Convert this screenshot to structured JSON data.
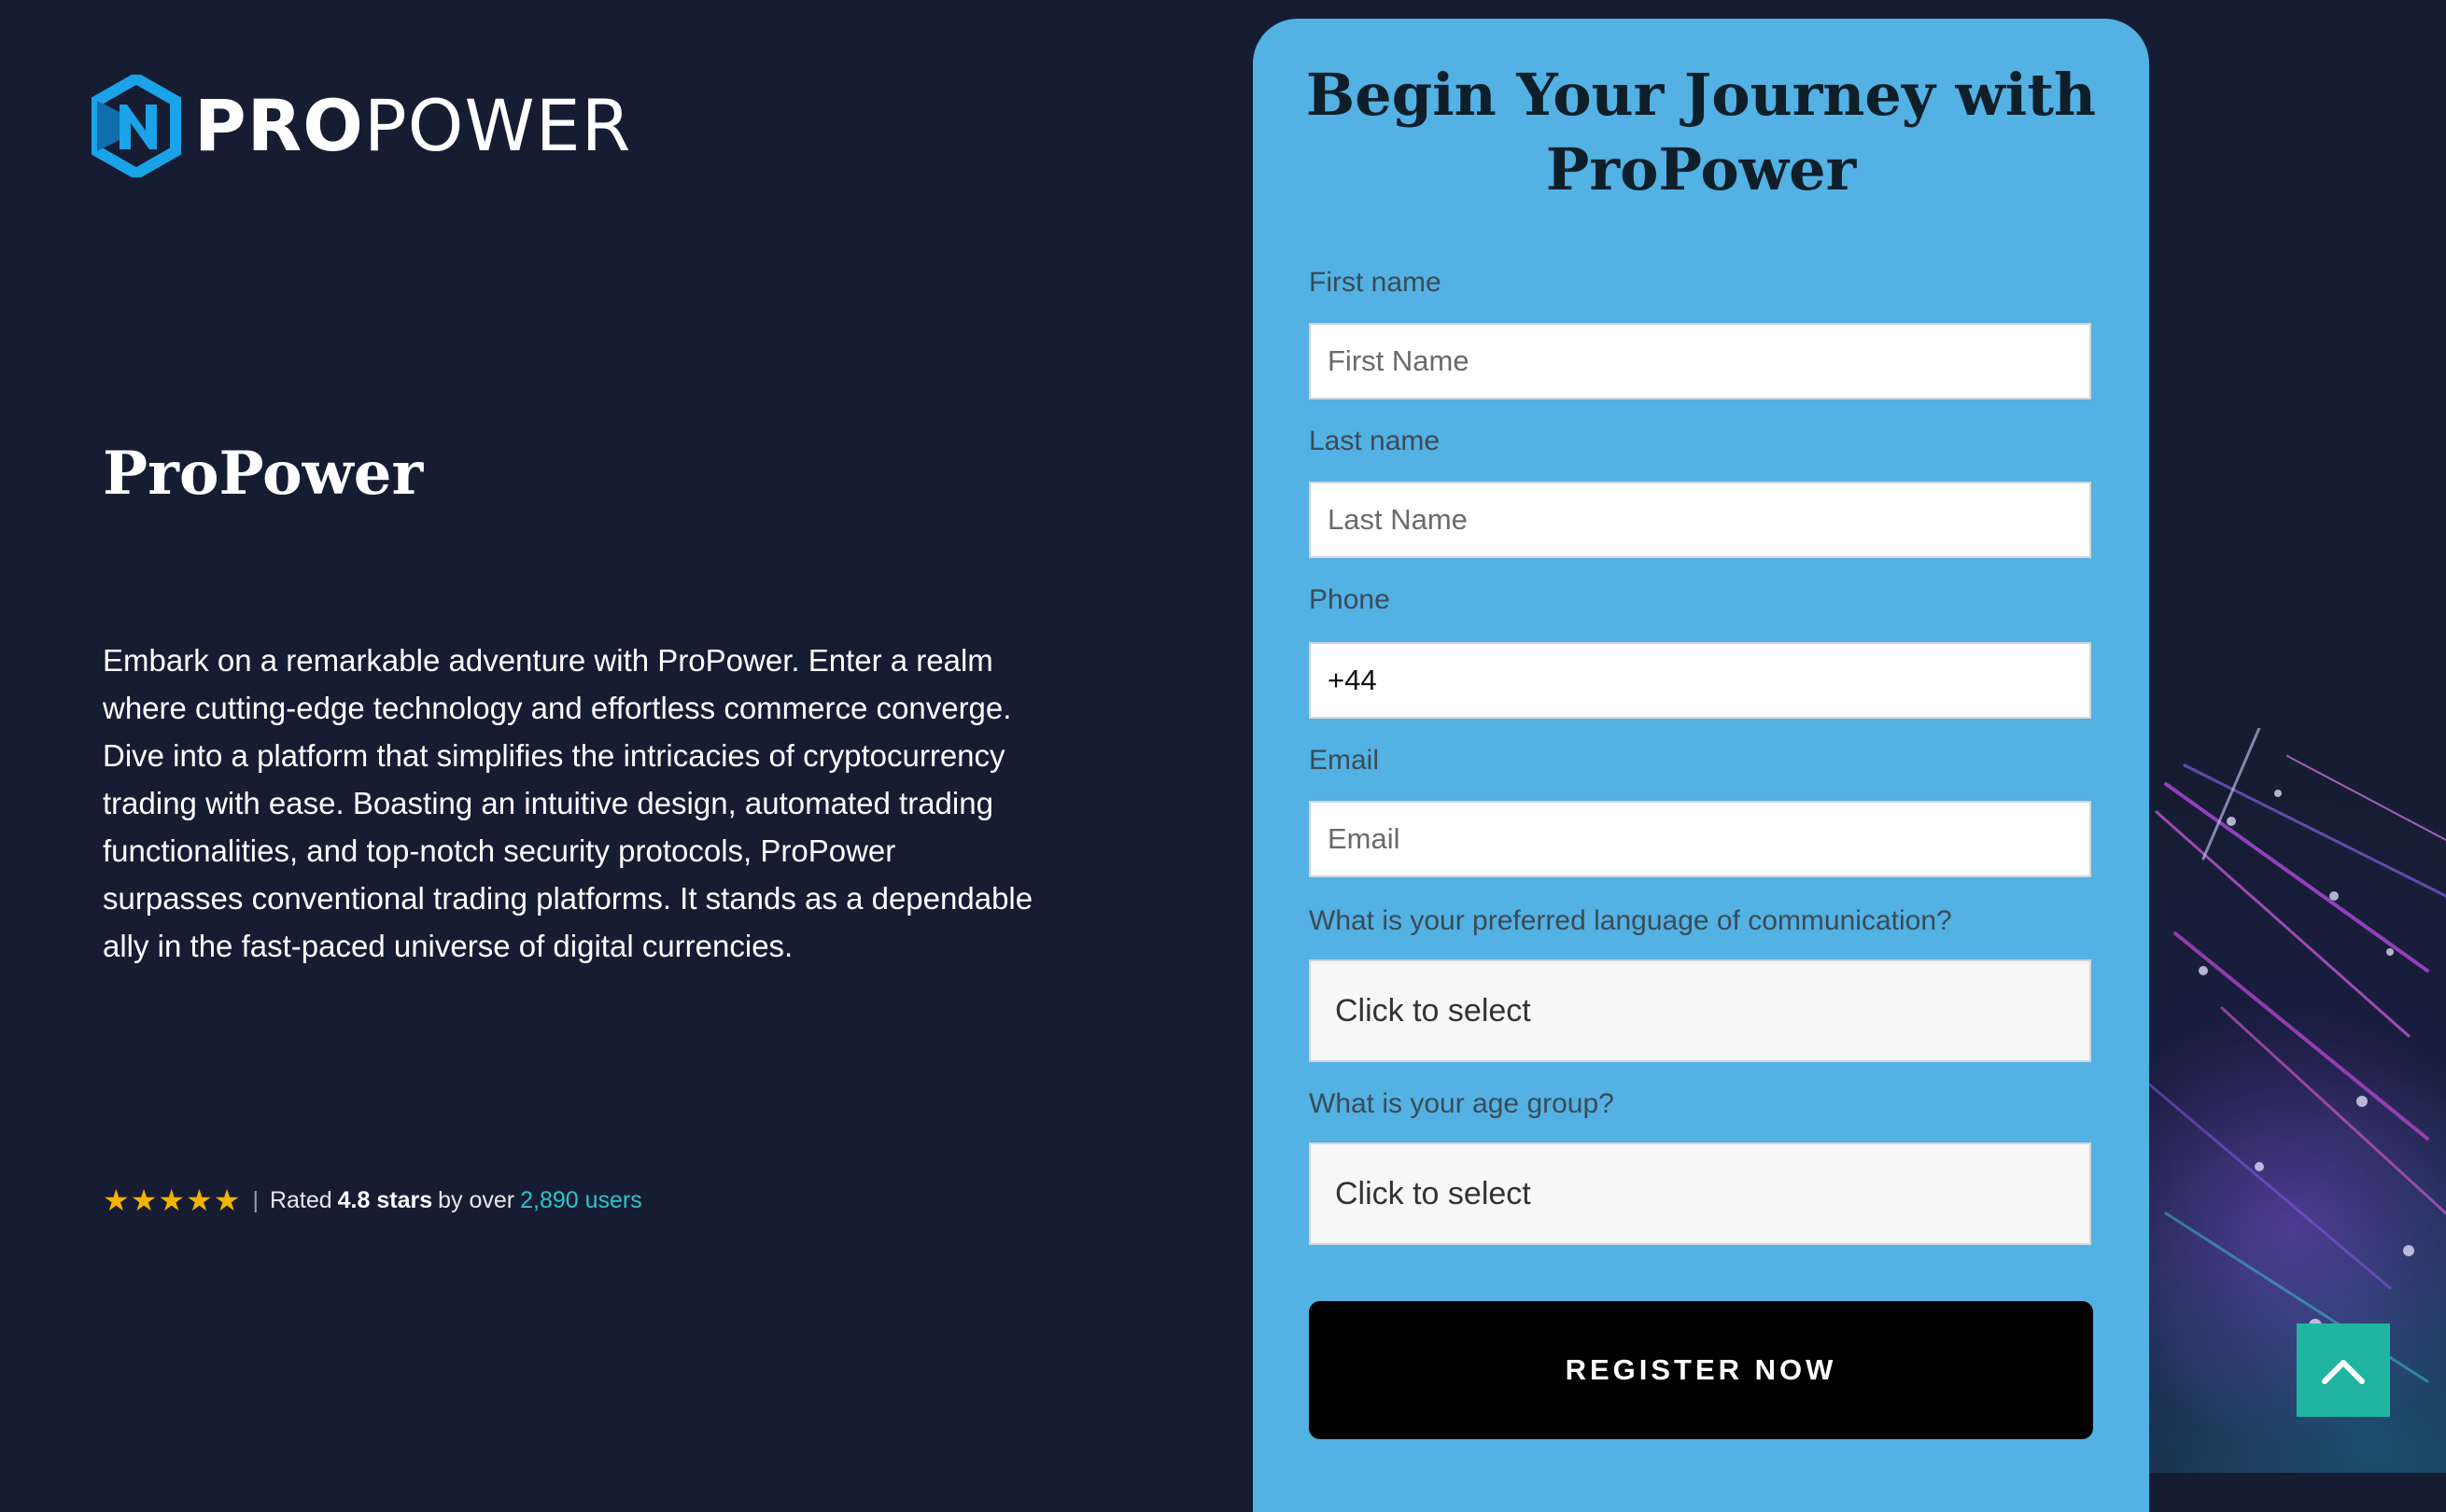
{
  "brand": {
    "logo_bold": "PRO",
    "logo_light": "POWER"
  },
  "hero": {
    "title": "ProPower",
    "description": "Embark on a remarkable adventure with ProPower. Enter a realm where cutting-edge technology and effortless commerce converge. Dive into a platform that simplifies the intricacies of cryptocurrency trading with ease. Boasting an intuitive design, automated trading functionalities, and top-notch security protocols, ProPower surpasses conventional trading platforms. It stands as a dependable ally in the fast-paced universe of digital currencies."
  },
  "rating": {
    "stars": "★★★★★",
    "separator": "|",
    "prefix": "Rated",
    "score": "4.8 stars",
    "by": "by over",
    "users": "2,890 users",
    "star_color": "#f5b301",
    "users_color": "#2ec4c9"
  },
  "form": {
    "title": "Begin Your Journey with ProPower",
    "first_name_label": "First name",
    "first_name_placeholder": "First Name",
    "last_name_label": "Last name",
    "last_name_placeholder": "Last Name",
    "phone_label": "Phone",
    "phone_value": "+44",
    "email_label": "Email",
    "email_placeholder": "Email",
    "language_label": "What is your preferred language of communication?",
    "language_value": "Click to select",
    "age_label": "What is your age group?",
    "age_value": "Click to select",
    "submit_label": "REGISTER NOW",
    "card_color": "#53b1e3",
    "button_color": "#000000"
  },
  "scroll_top": {
    "icon": "chevron-up-icon",
    "color": "#1fb5a0"
  }
}
